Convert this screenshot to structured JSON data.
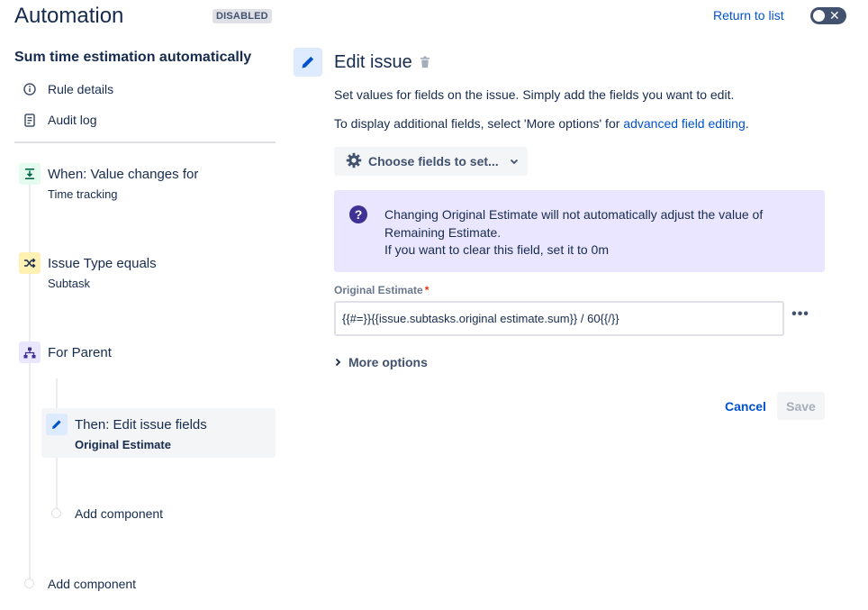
{
  "header": {
    "title": "Automation",
    "status_badge": "DISABLED",
    "return_link": "Return to list",
    "toggle_state": "off"
  },
  "sidebar": {
    "rule_name": "Sum time estimation automatically",
    "links": [
      {
        "label": "Rule details",
        "icon": "info-icon"
      },
      {
        "label": "Audit log",
        "icon": "document-icon"
      }
    ],
    "steps": [
      {
        "title": "When: Value changes for",
        "subtitle": "Time tracking",
        "icon": "trigger-icon",
        "color": "#e3fcef"
      },
      {
        "title": "Issue Type equals",
        "subtitle": "Subtask",
        "icon": "shuffle-icon",
        "color": "#fff0b3"
      },
      {
        "title": "For Parent",
        "subtitle": "",
        "icon": "hierarchy-icon",
        "color": "#eae6ff"
      },
      {
        "title": "Then: Edit issue fields",
        "subtitle": "Original Estimate",
        "icon": "pencil-icon",
        "color": "#deebff"
      }
    ],
    "add_component_inner": "Add component",
    "add_component_outer": "Add component"
  },
  "panel": {
    "title": "Edit issue",
    "description_1": "Set values for fields on the issue. Simply add the fields you want to edit.",
    "description_2_prefix": "To display additional fields, select 'More options' for ",
    "description_2_link": "advanced field editing",
    "description_2_suffix": ".",
    "choose_fields_label": "Choose fields to set...",
    "info": {
      "line_1": "Changing Original Estimate will not automatically adjust the value of",
      "line_2": "Remaining Estimate.",
      "line_3": "If you want to clear this field, set it to 0m"
    },
    "field": {
      "label": "Original Estimate",
      "required_marker": "*",
      "value": "{{#=}}{{issue.subtasks.original estimate.sum}} / 60{{/}}"
    },
    "more_dots": "•••",
    "more_options_label": "More options",
    "cancel_label": "Cancel",
    "save_label": "Save"
  },
  "colors": {
    "primary_link": "#0052cc",
    "text": "#172b4d",
    "info_bg": "#eae6ff",
    "info_icon": "#403294"
  }
}
